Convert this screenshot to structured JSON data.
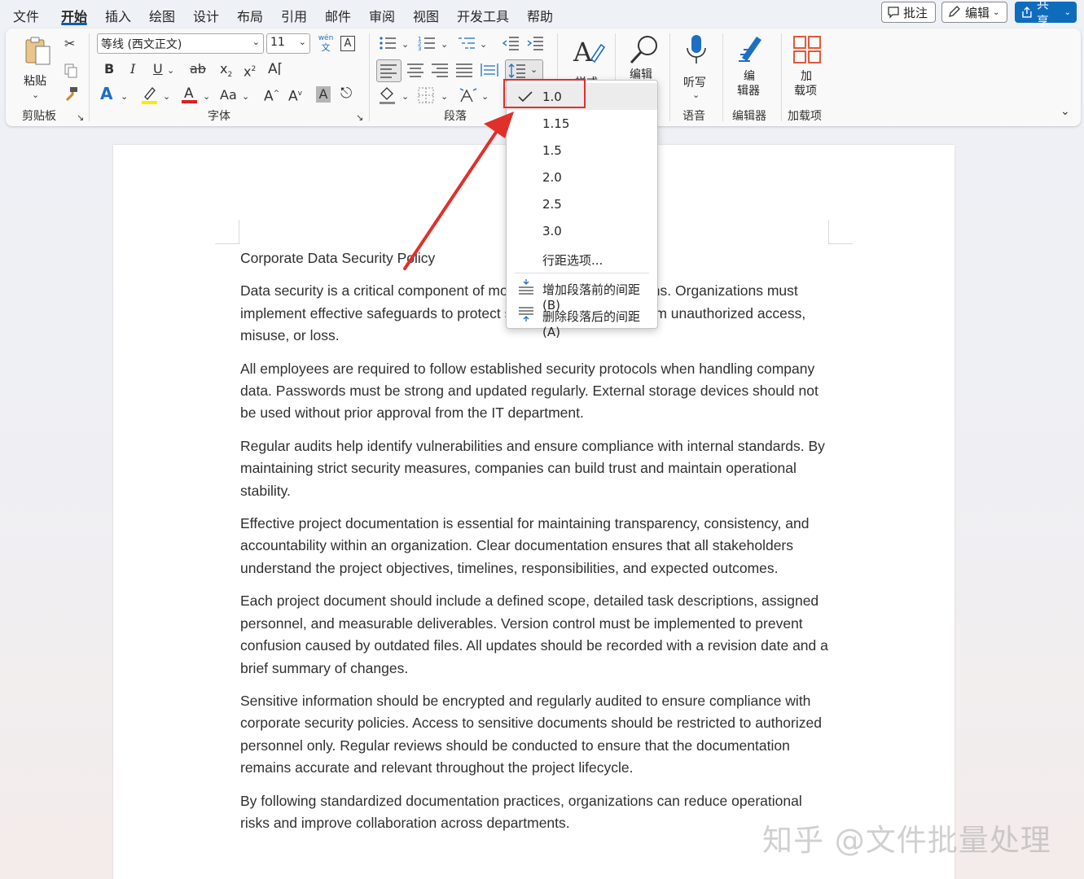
{
  "menubar": {
    "tabs": [
      "文件",
      "开始",
      "插入",
      "绘图",
      "设计",
      "布局",
      "引用",
      "邮件",
      "审阅",
      "视图",
      "开发工具",
      "帮助"
    ],
    "comment_btn": "批注",
    "edit_btn": "编辑",
    "share_btn": "共享"
  },
  "ribbon": {
    "paste_label": "粘贴",
    "clipboard_group": "剪贴板",
    "font_name": "等线 (西文正文)",
    "font_size": "11",
    "font_group": "字体",
    "paragraph_group": "段落",
    "styles_label": "样式",
    "editing_label": "编辑",
    "dictate_label": "听写",
    "voice_group": "语音",
    "editor_label_1": "编",
    "editor_label_2": "辑器",
    "editor_group": "编辑器",
    "addins_label_1": "加",
    "addins_label_2": "载项",
    "addins_group": "加载项",
    "wen_label": "wén",
    "wen_char": "文",
    "case_label": "Aa"
  },
  "line_spacing_menu": {
    "options": [
      "1.0",
      "1.15",
      "1.5",
      "2.0",
      "2.5",
      "3.0"
    ],
    "selected": "1.0",
    "line_options": "行距选项...",
    "add_space_before": "增加段落前的间距(B)",
    "remove_space_after": "删除段落后的间距(A)"
  },
  "document": {
    "title": "Corporate Data Security Policy",
    "paragraphs": [
      "Data security is a critical component of modern business operations. Organizations must implement effective safeguards to protect sensitive information from unauthorized access, misuse, or loss.",
      "All employees are required to follow established security protocols when handling company data. Passwords must be strong and updated regularly. External storage devices should not be used without prior approval from the IT department.",
      "Regular audits help identify vulnerabilities and ensure compliance with internal standards. By maintaining strict security measures, companies can build trust and maintain operational stability.",
      "Effective project documentation is essential for maintaining transparency, consistency, and accountability within an organization. Clear documentation ensures that all stakeholders understand the project objectives, timelines, responsibilities, and expected outcomes.",
      "Each project document should include a defined scope, detailed task descriptions, assigned personnel, and measurable deliverables. Version control must be implemented to prevent confusion caused by outdated files. All updates should be recorded with a revision date and a brief summary of changes.",
      "Sensitive information should be encrypted and regularly audited to ensure compliance with corporate security policies. Access to sensitive documents should be restricted to authorized personnel only. Regular reviews should be conducted to ensure that the documentation remains accurate and relevant throughout the project lifecycle.",
      "By following standardized documentation practices, organizations can reduce operational risks and improve collaboration across departments."
    ]
  },
  "watermark": "知乎 @文件批量处理",
  "colors": {
    "accent": "#0f6cbd",
    "highlight_box": "#e0302a",
    "font_color_bar": "#e02020",
    "highlight_color_bar": "#ffe800"
  }
}
